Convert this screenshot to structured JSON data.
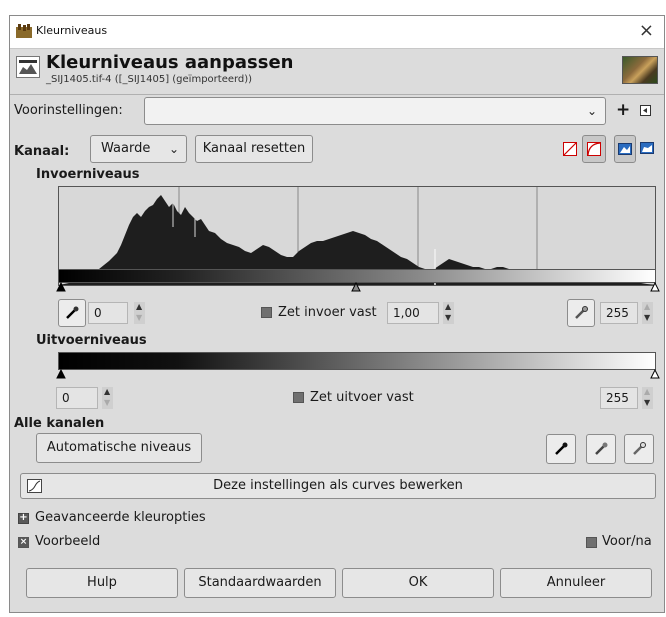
{
  "window": {
    "title": "Kleurniveaus",
    "close_glyph": "×"
  },
  "header": {
    "title": "Kleurniveaus aanpassen",
    "subtitle": "_SIJ1405.tif-4 ([_SIJ1405] (geïmporteerd))"
  },
  "presets": {
    "label": "Voorinstellingen:",
    "value": "",
    "add_glyph": "+"
  },
  "channel": {
    "label": "Kanaal:",
    "value": "Waarde",
    "reset_label": "Kanaal resetten"
  },
  "input_levels": {
    "heading": "Invoerniveaus",
    "low_value": "0",
    "gamma_label": "Zet invoer vast",
    "gamma_value": "1,00",
    "high_value": "255"
  },
  "output_levels": {
    "heading": "Uitvoerniveaus",
    "low_value": "0",
    "lock_label": "Zet uitvoer vast",
    "high_value": "255"
  },
  "all_channels": {
    "heading": "Alle kanalen",
    "auto_label": "Automatische niveaus"
  },
  "curves_button": "Deze instellingen als curves bewerken",
  "advanced": {
    "label": "Geavanceerde kleuropties",
    "state": "collapsed"
  },
  "preview": {
    "label": "Voorbeeld",
    "checked": true
  },
  "split_view": {
    "label": "Voor/na",
    "checked": false
  },
  "buttons": {
    "help": "Hulp",
    "defaults": "Standaardwaarden",
    "ok": "OK",
    "cancel": "Annuleer"
  },
  "colors": {
    "dialog_bg": "#dcdcdc",
    "histogram_fill": "#1e1e1e",
    "histogram_bg": "#d8d8d8"
  }
}
